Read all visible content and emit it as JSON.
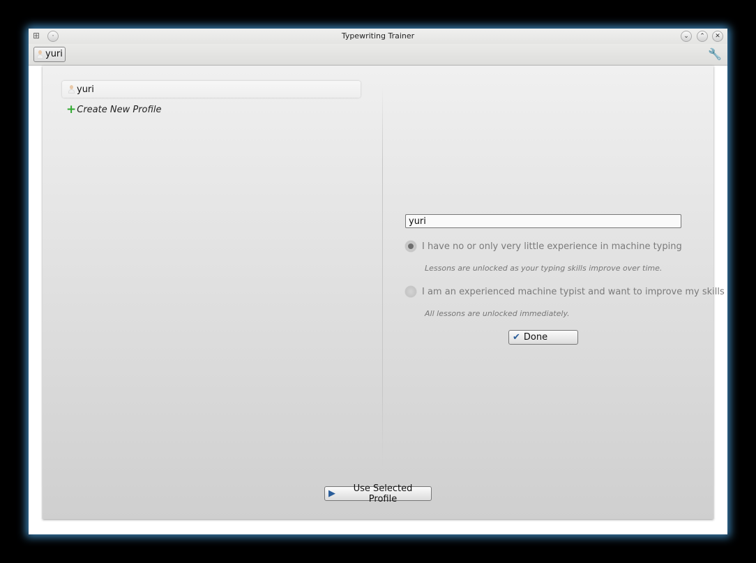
{
  "window": {
    "title": "Typewriting Trainer"
  },
  "toolbar": {
    "profile_button": "yuri",
    "settings_icon": "wrench-icon"
  },
  "profiles": {
    "items": [
      {
        "name": "yuri"
      }
    ],
    "create_label": "Create New Profile"
  },
  "editor": {
    "name_value": "yuri",
    "options": [
      {
        "label": "I have no or only very little experience in machine typing",
        "hint": "Lessons are unlocked as your typing skills improve over time.",
        "selected": true
      },
      {
        "label": "I am an experienced machine typist and want to improve my skills",
        "hint": "All lessons are unlocked immediately.",
        "selected": false
      }
    ],
    "done_label": "Done"
  },
  "footer": {
    "use_profile_label": "Use Selected Profile"
  },
  "colors": {
    "accent_glow": "#3a7fb0",
    "create_plus": "#2ea82e",
    "check": "#2a5d9a"
  }
}
